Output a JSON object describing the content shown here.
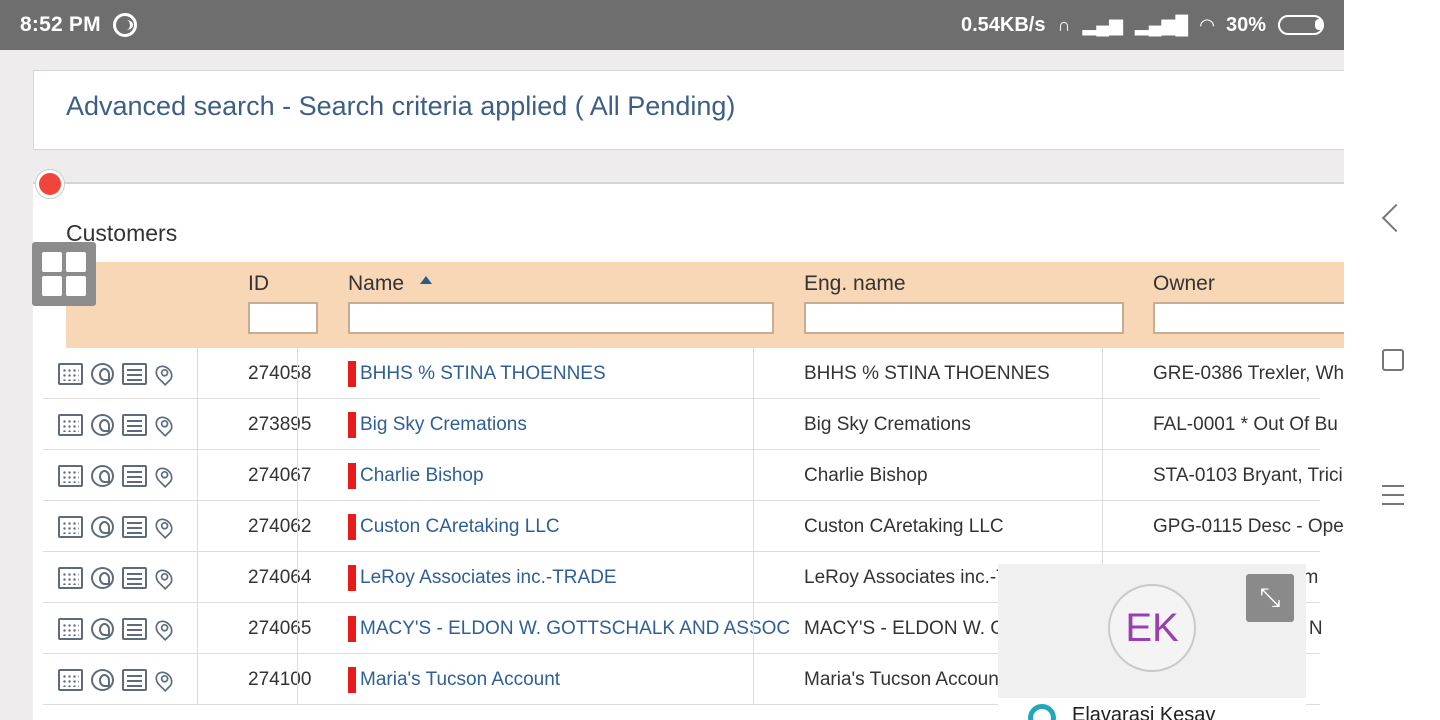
{
  "statusbar": {
    "time": "8:52 PM",
    "speed": "0.54KB/s",
    "battery": "30%"
  },
  "search": {
    "title": "Advanced search - Search criteria applied ( All Pending)"
  },
  "customers": {
    "title": "Customers",
    "columns": {
      "id": "ID",
      "name": "Name",
      "eng_name": "Eng. name",
      "owner": "Owner"
    },
    "rows": [
      {
        "id": "274058",
        "name": "BHHS % STINA THOENNES",
        "eng": "BHHS % STINA THOENNES",
        "owner": "GRE-0386 Trexler, Wh"
      },
      {
        "id": "273895",
        "name": "Big Sky Cremations",
        "eng": "Big Sky Cremations",
        "owner": "FAL-0001 * Out Of Bu"
      },
      {
        "id": "274067",
        "name": "Charlie Bishop",
        "eng": "Charlie Bishop",
        "owner": "STA-0103 Bryant, Trici"
      },
      {
        "id": "274062",
        "name": "Custon CAretaking LLC",
        "eng": "Custon CAretaking LLC",
        "owner": "GPG-0115 Desc - Ope"
      },
      {
        "id": "274064",
        "name": "LeRoy Associates inc.-TRADE",
        "eng": "LeRoy Associates inc.-TRADE",
        "owner": "",
        "owner_tail": "t, Jim"
      },
      {
        "id": "274065",
        "name": "MACY'S - ELDON W. GOTTSCHALK AND ASSOC",
        "eng": "MACY'S - ELDON W. GOTTSCHALK AND ASSOC",
        "owner": "",
        "owner_tail": "nts, N"
      },
      {
        "id": "274100",
        "name": "Maria's Tucson Account",
        "eng": "Maria's Tucson Account",
        "owner": ""
      }
    ]
  },
  "chat": {
    "initials": "EK",
    "name": "Elavarasi Kesav"
  },
  "colors": {
    "accent_text": "#2f5f97",
    "header_bg": "#f7d7b5",
    "status_red": "#e81b1b"
  }
}
